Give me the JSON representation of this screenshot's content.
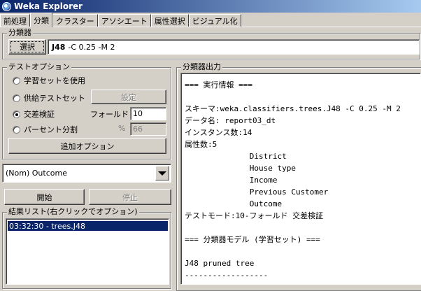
{
  "window": {
    "title": "Weka Explorer"
  },
  "tabs": [
    "前処理",
    "分類",
    "クラスター",
    "アソシエート",
    "属性選択",
    "ビジュアル化"
  ],
  "classifier": {
    "group_title": "分類器",
    "choose_label": "選択",
    "name": "J48",
    "options": "-C 0.25 -M 2"
  },
  "test_options": {
    "group_title": "テストオプション",
    "use_training": "学習セットを使用",
    "supplied_test": "供給テストセット",
    "settings_label": "設定",
    "cross_validation": "交差検証",
    "folds_label": "フォールド",
    "folds_value": "10",
    "percentage_split": "パーセント分割",
    "percent_symbol": "%",
    "percent_value": "66",
    "more_options": "追加オプション"
  },
  "class_attribute": {
    "selected": "(Nom) Outcome"
  },
  "controls": {
    "start": "開始",
    "stop": "停止"
  },
  "result_list": {
    "group_title": "結果リスト(右クリックでオプション)",
    "items": [
      "03:32:30 - trees.J48"
    ]
  },
  "output": {
    "group_title": "分類器出力",
    "lines": [
      "=== 実行情報 ===",
      "",
      "スキーマ:weka.classifiers.trees.J48 -C 0.25 -M 2",
      "データ名: report03_dt",
      "インスタンス数:14",
      "属性数:5",
      "              District",
      "              House type",
      "              Income",
      "              Previous Customer",
      "              Outcome",
      "テストモード:10-フォールド 交差検証",
      "",
      "=== 分類器モデル (学習セット) ===",
      "",
      "J48 pruned tree",
      "------------------"
    ]
  }
}
